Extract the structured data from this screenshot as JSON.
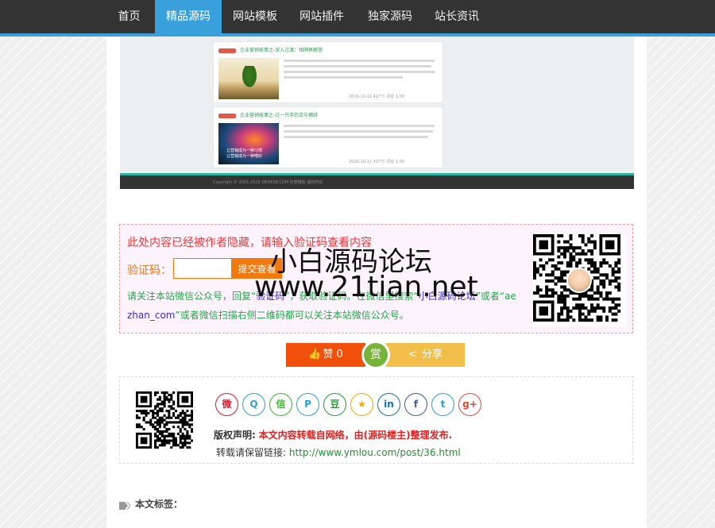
{
  "nav": {
    "items": [
      {
        "label": "首页",
        "active": false
      },
      {
        "label": "精品源码",
        "active": true
      },
      {
        "label": "网站模板",
        "active": false
      },
      {
        "label": "网站插件",
        "active": false
      },
      {
        "label": "独家源码",
        "active": false
      },
      {
        "label": "站长资讯",
        "active": false
      }
    ]
  },
  "preview": {
    "cards": [
      {
        "title": "企业营销故事之-深入过渡：相隔再解答",
        "meta": "2016-10-11   417℃   评论   1.00"
      },
      {
        "title": "企业营销故事之-过一只手的交与摘辞",
        "thumb_text": "让营销成为一种习惯\n让营销成为一种嗜好",
        "meta": "2016-10-11   417℃   评论   1.00"
      }
    ],
    "copyright": "Copyright © 2001-2015 DEDE58.COM 织梦模板 版权所有"
  },
  "hidden": {
    "title": "此处内容已经被作者隐藏，请输入验证码查看内容",
    "code_label": "验证码：",
    "input_value": "",
    "input_placeholder": "",
    "submit_label": "提交查看",
    "note_1": "请关注本站微信公众号，回复“",
    "note_keyword": "验证码",
    "note_2": "”，获取验证码。在微信里搜索“",
    "note_account": "小白源码论坛",
    "note_3": "”或者“ae",
    "note_4": "zhan_com",
    "note_5": "”或者微信扫描右侧二维码都可以关注本站微信公众号。"
  },
  "watermark": {
    "line1": "小白源码论坛",
    "line2": "www.21tian.net"
  },
  "actions": {
    "like_label": "赞 0",
    "reward_label": "赏",
    "share_label": "分享"
  },
  "share": {
    "icons": [
      {
        "name": "weibo-icon",
        "glyph": "微",
        "color": "#e6162d"
      },
      {
        "name": "qq-icon",
        "glyph": "Q",
        "color": "#2aa0e0"
      },
      {
        "name": "wechat-icon",
        "glyph": "信",
        "color": "#3bb131"
      },
      {
        "name": "pinterest-icon",
        "glyph": "P",
        "color": "#2a9fd8"
      },
      {
        "name": "douban-icon",
        "glyph": "豆",
        "color": "#2a9a3a"
      },
      {
        "name": "favorite-icon",
        "glyph": "★",
        "color": "#f0a800"
      },
      {
        "name": "linkedin-icon",
        "glyph": "in",
        "color": "#1a6fb0"
      },
      {
        "name": "facebook-icon",
        "glyph": "f",
        "color": "#3b5998"
      },
      {
        "name": "twitter-icon",
        "glyph": "t",
        "color": "#2aa0e0"
      },
      {
        "name": "googleplus-icon",
        "glyph": "g+",
        "color": "#dd4b39"
      }
    ],
    "copyright_label": "版权声明:",
    "copyright_text": "本文内容转载自网络，由(源码楼主)整理发布.",
    "repost_label": "转载请保留链接:",
    "repost_url": "http://www.ymlou.com/post/36.html"
  },
  "tags": {
    "label": "本文标签："
  }
}
